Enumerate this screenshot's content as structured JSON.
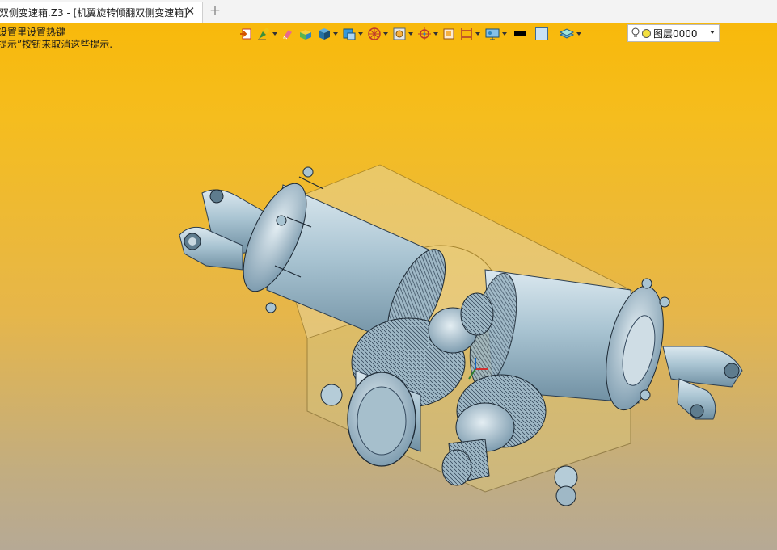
{
  "tab": {
    "title": "双侧变速箱.Z3 - [机翼旋转倾翻双侧变速箱]",
    "close_glyph": "✕",
    "add_glyph": "+"
  },
  "hint": {
    "line1": "设置里设置热键",
    "line2": "提示”按钮来取消这些提示."
  },
  "toolbar": {
    "icons": [
      "import-icon",
      "paint-icon",
      "eraser-icon",
      "box-color-icon",
      "cube-icon",
      "view-cube-icon",
      "section-icon",
      "zoom-fit-icon",
      "center-icon",
      "frame-icon",
      "dimension-icon",
      "display-icon",
      "line-color-icon",
      "fill-color-icon",
      "layer-stack-icon"
    ],
    "layer_value": "图层0000"
  },
  "colors": {
    "viewport_top": "#f8b90b",
    "viewport_bottom": "#b6a995",
    "part_blue": "#a9c4d2",
    "transparent_part": "#d8c27a"
  }
}
